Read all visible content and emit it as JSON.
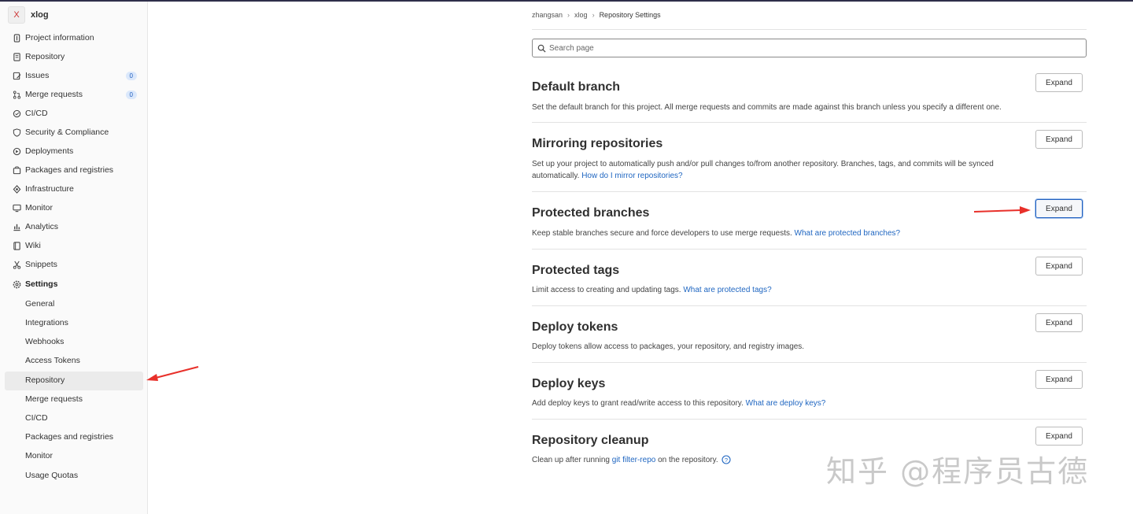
{
  "project": {
    "avatar_letter": "X",
    "name": "xlog"
  },
  "nav": [
    {
      "label": "Project information",
      "icon": "project-information-icon"
    },
    {
      "label": "Repository",
      "icon": "repository-icon"
    },
    {
      "label": "Issues",
      "icon": "issues-icon",
      "count": "0"
    },
    {
      "label": "Merge requests",
      "icon": "merge-requests-icon",
      "count": "0"
    },
    {
      "label": "CI/CD",
      "icon": "ci-cd-icon"
    },
    {
      "label": "Security & Compliance",
      "icon": "shield-icon"
    },
    {
      "label": "Deployments",
      "icon": "deployments-icon"
    },
    {
      "label": "Packages and registries",
      "icon": "package-icon"
    },
    {
      "label": "Infrastructure",
      "icon": "infrastructure-icon"
    },
    {
      "label": "Monitor",
      "icon": "monitor-icon"
    },
    {
      "label": "Analytics",
      "icon": "analytics-icon"
    },
    {
      "label": "Wiki",
      "icon": "wiki-icon"
    },
    {
      "label": "Snippets",
      "icon": "snippets-icon"
    },
    {
      "label": "Settings",
      "icon": "settings-icon"
    }
  ],
  "settings_sub": [
    "General",
    "Integrations",
    "Webhooks",
    "Access Tokens",
    "Repository",
    "Merge requests",
    "CI/CD",
    "Packages and registries",
    "Monitor",
    "Usage Quotas"
  ],
  "breadcrumb": [
    "zhangsan",
    "xlog",
    "Repository Settings"
  ],
  "search": {
    "placeholder": "Search page"
  },
  "expand_label": "Expand",
  "sections": [
    {
      "title": "Default branch",
      "desc": "Set the default branch for this project. All merge requests and commits are made against this branch unless you specify a different one.",
      "link": ""
    },
    {
      "title": "Mirroring repositories",
      "desc": "Set up your project to automatically push and/or pull changes to/from another repository. Branches, tags, and commits will be synced automatically.",
      "link": "How do I mirror repositories?"
    },
    {
      "title": "Protected branches",
      "desc": "Keep stable branches secure and force developers to use merge requests.",
      "link": "What are protected branches?"
    },
    {
      "title": "Protected tags",
      "desc": "Limit access to creating and updating tags.",
      "link": "What are protected tags?"
    },
    {
      "title": "Deploy tokens",
      "desc": "Deploy tokens allow access to packages, your repository, and registry images.",
      "link": ""
    },
    {
      "title": "Deploy keys",
      "desc": "Add deploy keys to grant read/write access to this repository.",
      "link": "What are deploy keys?"
    },
    {
      "title": "Repository cleanup",
      "desc_pre": "Clean up after running",
      "link": "git filter-repo",
      "desc_post": "on the repository."
    }
  ],
  "watermark": "知乎 @程序员古德",
  "colors": {
    "link": "#1f66c1",
    "arrow": "#e8302a",
    "badge_bg": "#dbe8fb"
  }
}
